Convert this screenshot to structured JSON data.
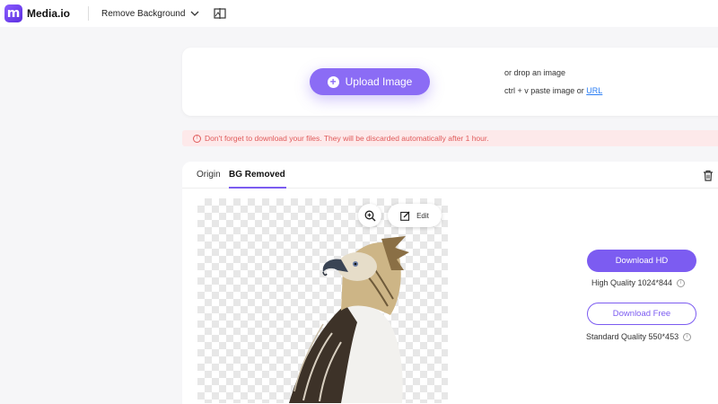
{
  "app": {
    "logo_letter": "m",
    "name": "Media.io",
    "tool_selector": "Remove Background",
    "brand_color": "#7c5cf1"
  },
  "upload": {
    "button_label": "Upload Image",
    "drop_text": "or drop an image",
    "paste_text": "ctrl + v paste image or ",
    "url_link": "URL"
  },
  "warning": {
    "text": "Don't forget to download your files. They will be discarded automatically after 1 hour."
  },
  "result": {
    "tabs": [
      {
        "label": "Origin",
        "active": false
      },
      {
        "label": "BG Removed",
        "active": true
      }
    ],
    "edit_label": "Edit",
    "download_hd_label": "Download HD",
    "hd_quality": "High Quality 1024*844",
    "download_free_label": "Download Free",
    "free_quality": "Standard Quality 550*453"
  },
  "icons": [
    "logo-icon",
    "chevron-down-icon",
    "compare-icon",
    "plus-icon",
    "info-icon",
    "trash-icon",
    "zoom-in-icon",
    "edit-icon"
  ]
}
